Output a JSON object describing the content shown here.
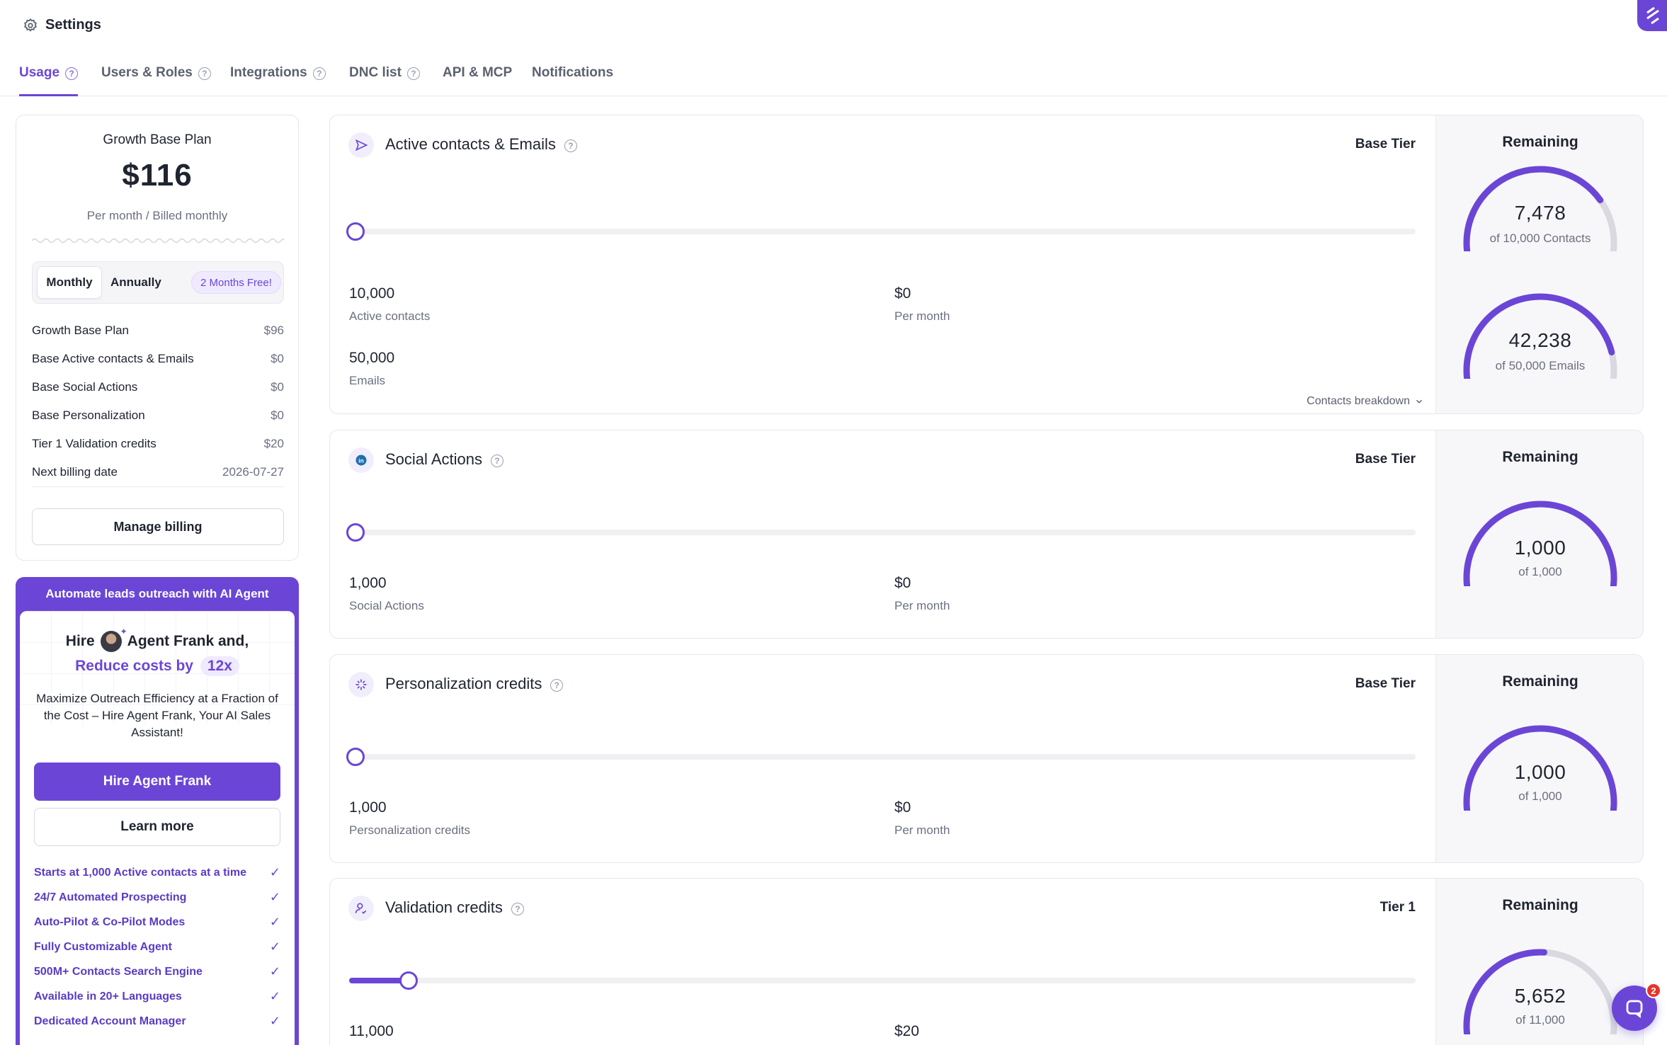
{
  "header": {
    "title": "Settings",
    "settings_icon": "gear-icon"
  },
  "tabs": [
    {
      "label": "Usage",
      "active": true,
      "help": true
    },
    {
      "label": "Users & Roles",
      "help": true
    },
    {
      "label": "Integrations",
      "help": true
    },
    {
      "label": "DNC list",
      "help": true
    },
    {
      "label": "API & MCP",
      "help": false
    },
    {
      "label": "Notifications",
      "help": false
    }
  ],
  "plan": {
    "name": "Growth Base Plan",
    "price": "$116",
    "period": "Per month / Billed monthly",
    "toggle": {
      "monthly": "Monthly",
      "annually": "Annually",
      "badge": "2 Months Free!"
    },
    "lines": [
      {
        "label": "Growth Base Plan",
        "value": "$96"
      },
      {
        "label": "Base Active contacts & Emails",
        "value": "$0"
      },
      {
        "label": "Base Social Actions",
        "value": "$0"
      },
      {
        "label": "Base Personalization",
        "value": "$0"
      },
      {
        "label": "Tier 1 Validation credits",
        "value": "$20"
      },
      {
        "label": "Next billing date",
        "value": "2026-07-27"
      }
    ],
    "manage_label": "Manage billing"
  },
  "promo": {
    "header": "Automate leads outreach with AI Agent",
    "hire_prefix": "Hire",
    "hire_suffix": "Agent Frank and,",
    "reduce": "Reduce costs by",
    "reduce_badge": "12x",
    "description": "Maximize Outreach Efficiency at a Fraction of the Cost – Hire Agent Frank, Your AI Sales Assistant!",
    "hire_button": "Hire Agent Frank",
    "learn_button": "Learn more",
    "features": [
      "Starts at 1,000 Active contacts at a time",
      "24/7 Automated Prospecting",
      "Auto-Pilot & Co-Pilot Modes",
      "Fully Customizable Agent",
      "500M+ Contacts Search Engine",
      "Available in 20+ Languages",
      "Dedicated Account Manager"
    ]
  },
  "cards": {
    "contacts": {
      "title": "Active contacts & Emails",
      "tier": "Base Tier",
      "slider_fraction": 0,
      "stat1_num": "10,000",
      "stat1_sub": "Active contacts",
      "stat2_num": "$0",
      "stat2_sub": "Per month",
      "stat3_num": "50,000",
      "stat3_sub": "Emails",
      "breakdown": "Contacts breakdown",
      "remaining": "Remaining",
      "gauge1_val": "7,478",
      "gauge1_sub": "of 10,000 Contacts",
      "gauge1_fraction": 0.7478,
      "gauge2_val": "42,238",
      "gauge2_sub": "of 50,000 Emails",
      "gauge2_fraction": 0.84476
    },
    "social": {
      "title": "Social Actions",
      "tier": "Base Tier",
      "slider_fraction": 0,
      "stat1_num": "1,000",
      "stat1_sub": "Social Actions",
      "stat2_num": "$0",
      "stat2_sub": "Per month",
      "remaining": "Remaining",
      "gauge_val": "1,000",
      "gauge_sub": "of 1,000",
      "gauge_fraction": 1
    },
    "personalization": {
      "title": "Personalization credits",
      "tier": "Base Tier",
      "slider_fraction": 0,
      "stat1_num": "1,000",
      "stat1_sub": "Personalization credits",
      "stat2_num": "$0",
      "stat2_sub": "Per month",
      "remaining": "Remaining",
      "gauge_val": "1,000",
      "gauge_sub": "of 1,000",
      "gauge_fraction": 1
    },
    "validation": {
      "title": "Validation credits",
      "tier": "Tier 1",
      "slider_fraction": 0.05,
      "stat1_num": "11,000",
      "stat2_num": "$20",
      "remaining": "Remaining",
      "gauge_val": "5,652",
      "gauge_sub": "of 11,000",
      "gauge_fraction": 0.5138
    }
  },
  "chat": {
    "badge": "2"
  },
  "colors": {
    "accent": "#6b46d6",
    "track": "#f0f0f3",
    "gauge_bg": "#d9d9df"
  }
}
